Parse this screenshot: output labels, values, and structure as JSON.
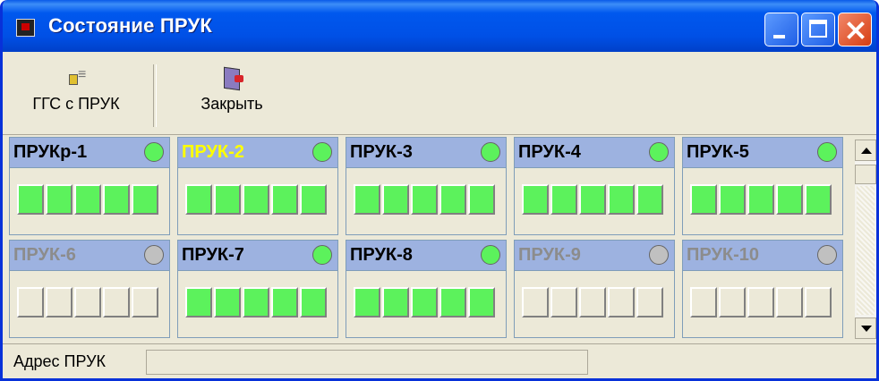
{
  "window": {
    "title": "Состояние ПРУК"
  },
  "toolbar": {
    "ggs": {
      "label": "ГГС с ПРУК",
      "icon": "speaker-icon"
    },
    "close": {
      "label": "Закрыть",
      "icon": "exit-door-icon"
    }
  },
  "colors": {
    "active": "#5cf25c",
    "inactive": "#c0c0c0",
    "header": "#9db2e0",
    "highlight_name": "#ffff00"
  },
  "panels": [
    {
      "name": "ПРУКр-1",
      "status": "online",
      "channels": [
        1,
        1,
        1,
        1,
        1
      ]
    },
    {
      "name": "ПРУК-2",
      "status": "online",
      "name_color": "yellow",
      "channels": [
        1,
        1,
        1,
        1,
        1
      ]
    },
    {
      "name": "ПРУК-3",
      "status": "online",
      "channels": [
        1,
        1,
        1,
        1,
        1
      ]
    },
    {
      "name": "ПРУК-4",
      "status": "online",
      "channels": [
        1,
        1,
        1,
        1,
        1
      ]
    },
    {
      "name": "ПРУК-5",
      "status": "online",
      "channels": [
        1,
        1,
        1,
        1,
        1
      ]
    },
    {
      "name": "ПРУК-6",
      "status": "offline",
      "channels": [
        0,
        0,
        0,
        0,
        0
      ]
    },
    {
      "name": "ПРУК-7",
      "status": "online",
      "channels": [
        1,
        1,
        1,
        1,
        1
      ]
    },
    {
      "name": "ПРУК-8",
      "status": "online",
      "channels": [
        1,
        1,
        1,
        1,
        1
      ]
    },
    {
      "name": "ПРУК-9",
      "status": "offline",
      "channels": [
        0,
        0,
        0,
        0,
        0
      ]
    },
    {
      "name": "ПРУК-10",
      "status": "offline",
      "channels": [
        0,
        0,
        0,
        0,
        0
      ]
    }
  ],
  "status_bar": {
    "label": "Адрес ПРУК",
    "value": ""
  }
}
